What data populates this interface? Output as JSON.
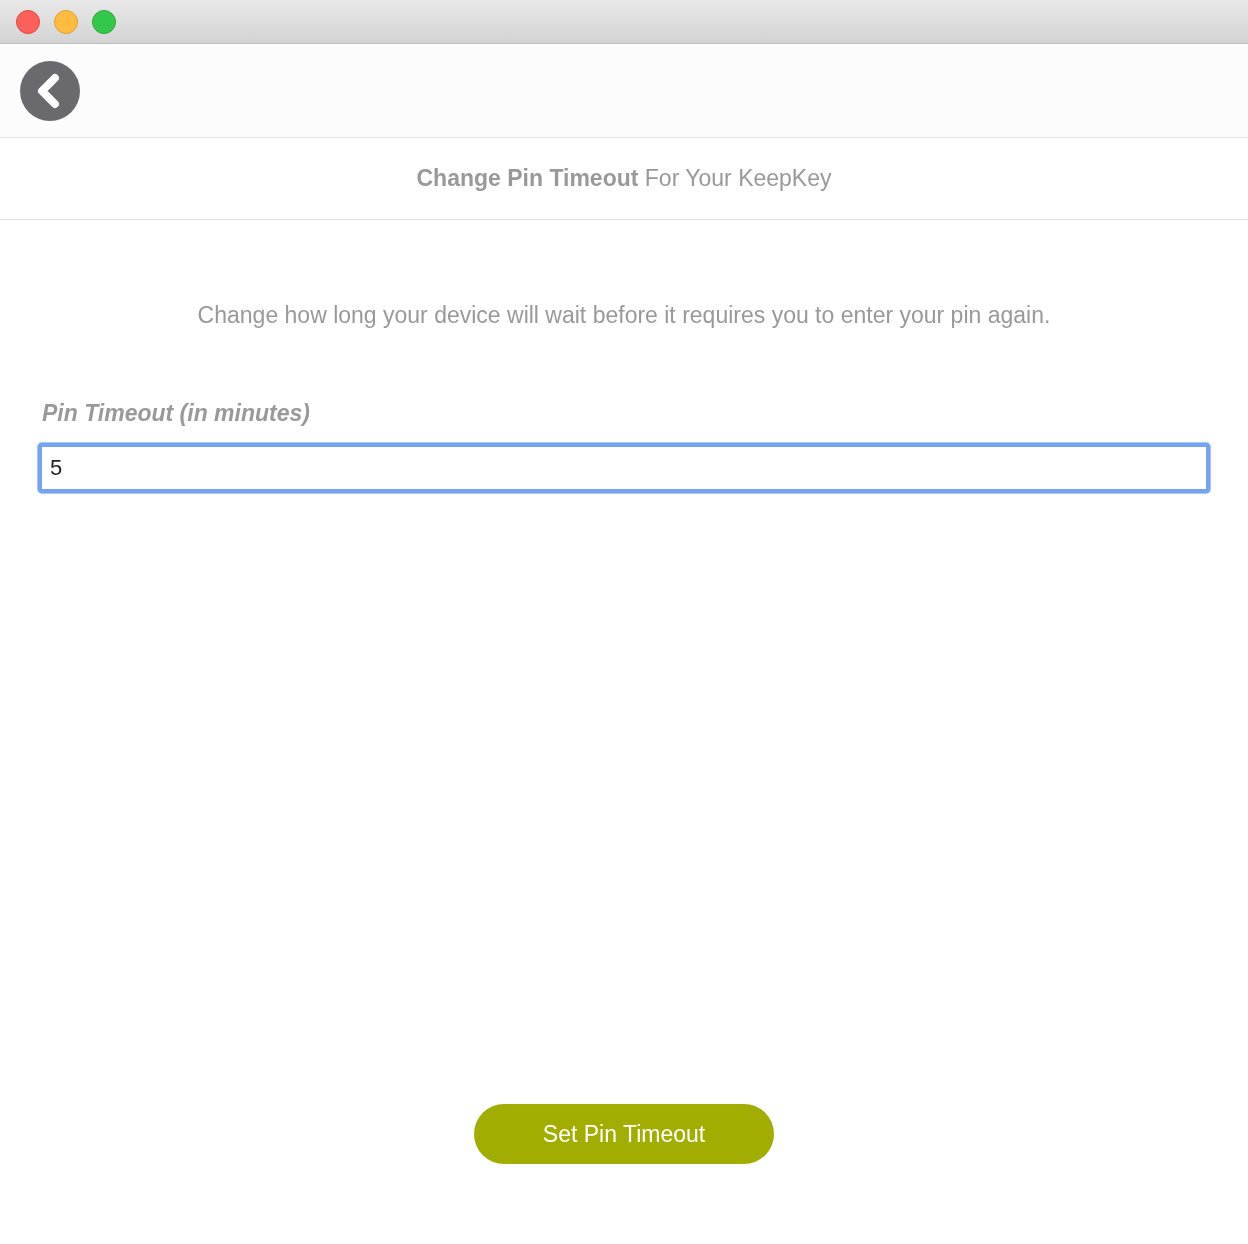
{
  "header": {
    "title": "**Change Pin Timeout** For Your KeepKey"
  },
  "description": "Change how long your device will wait before it requires you to enter your pin again.",
  "field": {
    "label": "Pin Timeout (in minutes)",
    "value": "5",
    "focused": true
  },
  "submit_button": "Set Pin Timeout"
}
